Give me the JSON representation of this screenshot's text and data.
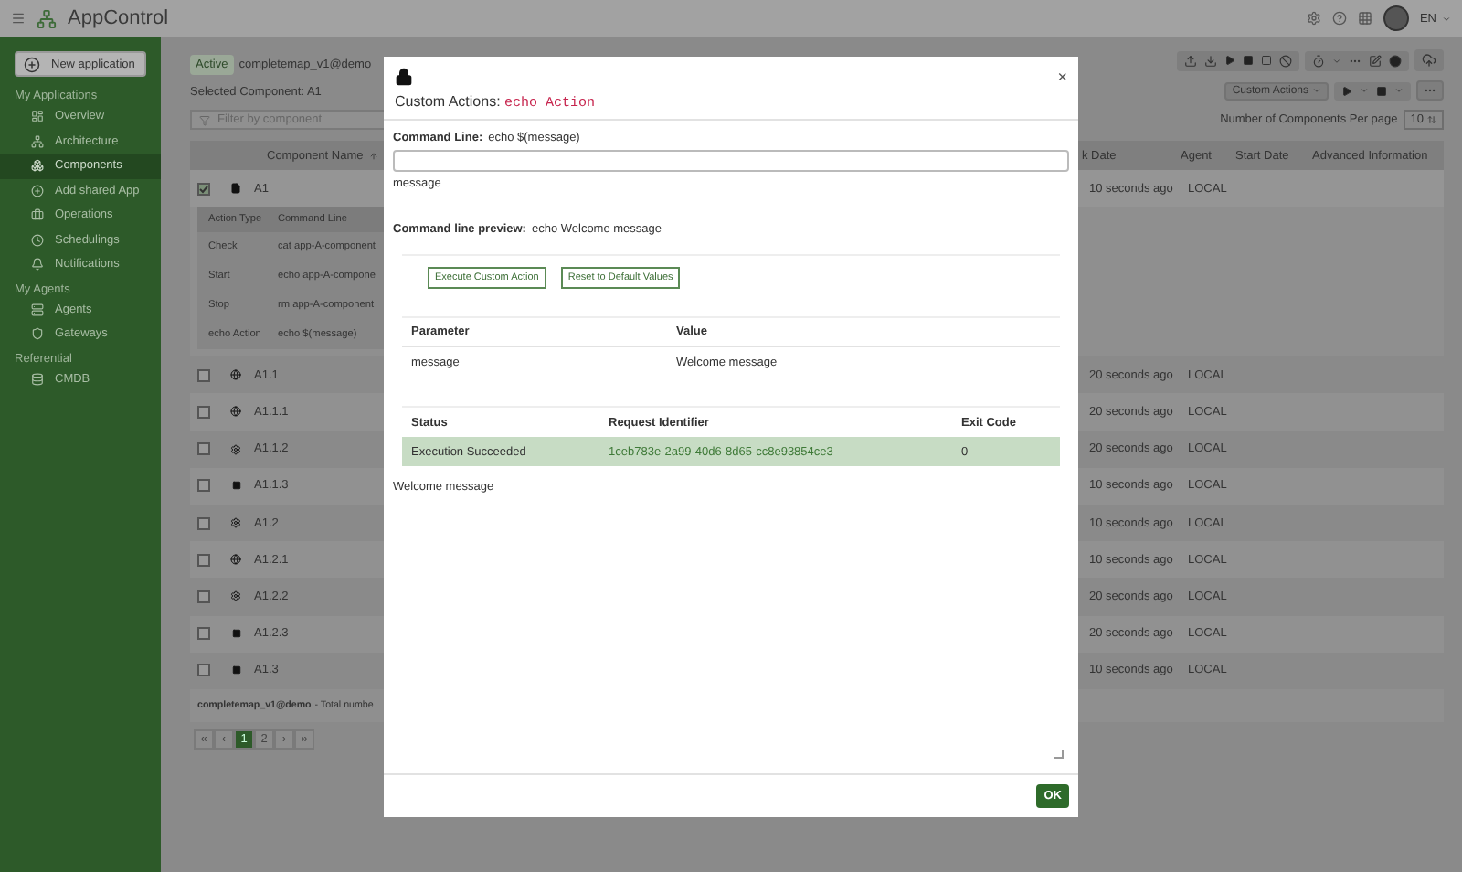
{
  "header": {
    "app_name": "AppControl",
    "language": "EN"
  },
  "sidebar": {
    "new_button": "New application",
    "sections": [
      {
        "title": "My Applications",
        "items": [
          {
            "label": "Overview",
            "selected": false
          },
          {
            "label": "Architecture",
            "selected": false
          },
          {
            "label": "Components",
            "selected": true
          },
          {
            "label": "Add shared App",
            "selected": false
          },
          {
            "label": "Operations",
            "selected": false
          },
          {
            "label": "Schedulings",
            "selected": false
          },
          {
            "label": "Notifications",
            "selected": false
          }
        ]
      },
      {
        "title": "My Agents",
        "items": [
          {
            "label": "Agents",
            "selected": false
          },
          {
            "label": "Gateways",
            "selected": false
          }
        ]
      },
      {
        "title": "Referential",
        "items": [
          {
            "label": "CMDB",
            "selected": false
          }
        ]
      }
    ]
  },
  "app_bar": {
    "status": "Active",
    "app": "completemap_v1@demo",
    "selected_component": "Selected Component: A1"
  },
  "filter": {
    "placeholder": "Filter by component"
  },
  "toolbar": {
    "custom_actions": "Custom Actions"
  },
  "per_page": {
    "label": "Number of Components Per page",
    "value": "10"
  },
  "table": {
    "columns": [
      "Component Name",
      "k Date",
      "Agent",
      "Start Date",
      "Advanced Information"
    ],
    "rows": [
      {
        "name": "A1",
        "kind": "file",
        "checked": true,
        "time": "10 seconds ago",
        "agent": "LOCAL",
        "actions": {
          "columns": [
            "Action Type",
            "Command Line"
          ],
          "rows": [
            [
              "Check",
              "cat app-A-component"
            ],
            [
              "Start",
              "echo app-A-compone"
            ],
            [
              "Stop",
              "rm app-A-component"
            ],
            [
              "echo Action",
              "echo $(message)"
            ]
          ]
        }
      },
      {
        "name": "A1.1",
        "kind": "globe",
        "checked": false,
        "time": "20 seconds ago",
        "agent": "LOCAL"
      },
      {
        "name": "A1.1.1",
        "kind": "globe",
        "checked": false,
        "time": "20 seconds ago",
        "agent": "LOCAL"
      },
      {
        "name": "A1.1.2",
        "kind": "gear",
        "checked": false,
        "time": "20 seconds ago",
        "agent": "LOCAL"
      },
      {
        "name": "A1.1.3",
        "kind": "square",
        "checked": false,
        "time": "10 seconds ago",
        "agent": "LOCAL"
      },
      {
        "name": "A1.2",
        "kind": "gear",
        "checked": false,
        "time": "10 seconds ago",
        "agent": "LOCAL"
      },
      {
        "name": "A1.2.1",
        "kind": "globe",
        "checked": false,
        "time": "10 seconds ago",
        "agent": "LOCAL"
      },
      {
        "name": "A1.2.2",
        "kind": "gear",
        "checked": false,
        "time": "20 seconds ago",
        "agent": "LOCAL"
      },
      {
        "name": "A1.2.3",
        "kind": "square",
        "checked": false,
        "time": "20 seconds ago",
        "agent": "LOCAL"
      },
      {
        "name": "A1.3",
        "kind": "square",
        "checked": false,
        "time": "10 seconds ago",
        "agent": "LOCAL"
      }
    ]
  },
  "table_footer": {
    "app": "completemap_v1@demo",
    "text": "- Total numbe"
  },
  "pagination": {
    "first": "«",
    "prev": "‹",
    "pages": [
      {
        "label": "1",
        "selected": true
      },
      {
        "label": "2",
        "selected": false
      }
    ],
    "next": "›",
    "last": "»"
  },
  "modal": {
    "title": "Custom Actions:",
    "action": "echo Action",
    "close": "×",
    "command_label": "Command Line:",
    "command": "echo $(message)",
    "field_label": "message",
    "preview_label": "Command line preview:",
    "preview": "echo Welcome message",
    "buttons": [
      "Execute Custom Action",
      "Reset to Default Values"
    ],
    "params": {
      "columns": [
        "Parameter",
        "Value"
      ],
      "rows": [
        [
          "message",
          "Welcome message"
        ]
      ]
    },
    "results": {
      "columns": [
        "Status",
        "Request Identifier",
        "Exit Code"
      ],
      "rows": [
        {
          "status": "Execution Succeeded",
          "id": "1ceb783e-2a99-40d6-8d65-cc8e93854ce3",
          "code": "0",
          "success": true
        }
      ]
    },
    "output": "Welcome message",
    "ok": "OK"
  }
}
